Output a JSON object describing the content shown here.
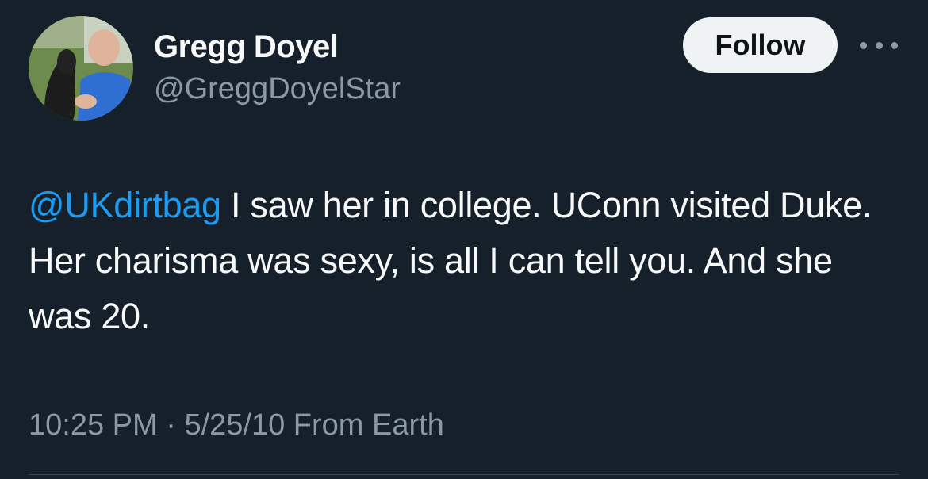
{
  "author": {
    "display_name": "Gregg Doyel",
    "handle": "@GreggDoyelStar"
  },
  "actions": {
    "follow_label": "Follow",
    "more_icon": "more-horizontal-icon"
  },
  "tweet": {
    "mention": "@UKdirtbag",
    "text": " I saw her in college. UConn visited Duke. Her charisma was sexy, is all I can tell you. And she was 20."
  },
  "meta": {
    "time": "10:25 PM",
    "separator": " · ",
    "date": "5/25/10",
    "location": " From Earth"
  },
  "colors": {
    "background": "#15202b",
    "text": "#f7f9f9",
    "secondary": "#8b98a5",
    "link": "#1d9bf0",
    "follow_bg": "#eff3f4"
  }
}
